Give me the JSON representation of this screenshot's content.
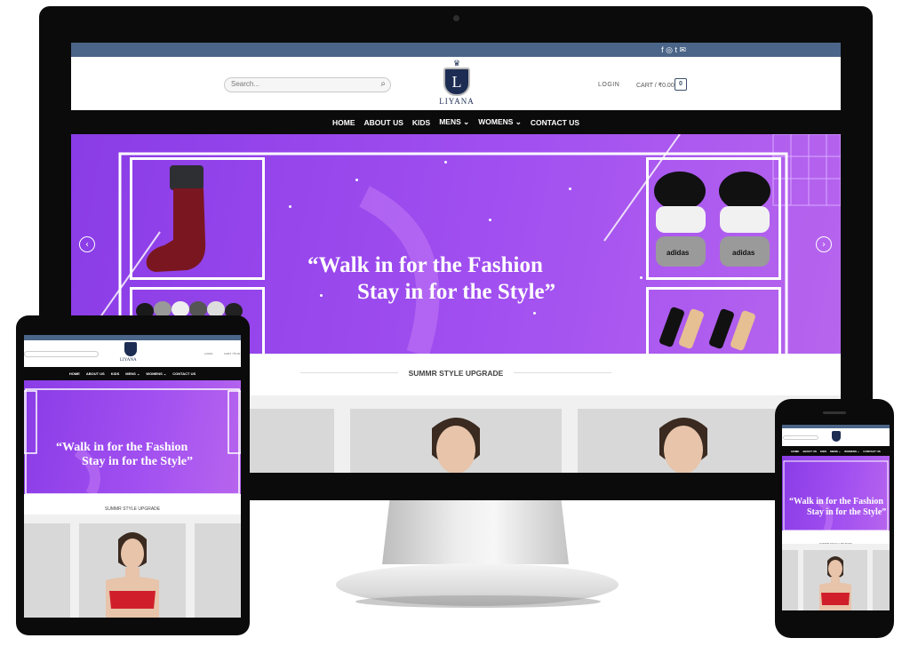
{
  "site": {
    "brand": "LIYANA",
    "logo_letter": "L"
  },
  "topbar": {
    "icons": [
      "facebook-icon",
      "instagram-icon",
      "twitter-icon",
      "mail-icon"
    ],
    "glyphs": "f ◎ t ✉"
  },
  "header": {
    "search_placeholder": "Search...",
    "login_label": "LOGIN",
    "cart_label": "CART / ₹0.00",
    "cart_count": "0"
  },
  "nav": {
    "items": [
      {
        "label": "HOME"
      },
      {
        "label": "ABOUT US"
      },
      {
        "label": "KIDS"
      },
      {
        "label": "MENS ⌄"
      },
      {
        "label": "WOMENS ⌄"
      },
      {
        "label": "CONTACT US"
      }
    ]
  },
  "hero": {
    "line1": "“Walk in for the Fashion",
    "line2": "Stay in for the Style”",
    "adidas_text": "adidas"
  },
  "section": {
    "title": "SUMMR STYLE UPGRADE"
  },
  "colors": {
    "topbar": "#4a6588",
    "nav": "#0b0b0b",
    "hero_start": "#8a3ce6",
    "hero_end": "#b765ee",
    "logo_navy": "#1c2c52",
    "product_bg": "#d8d8d8"
  }
}
